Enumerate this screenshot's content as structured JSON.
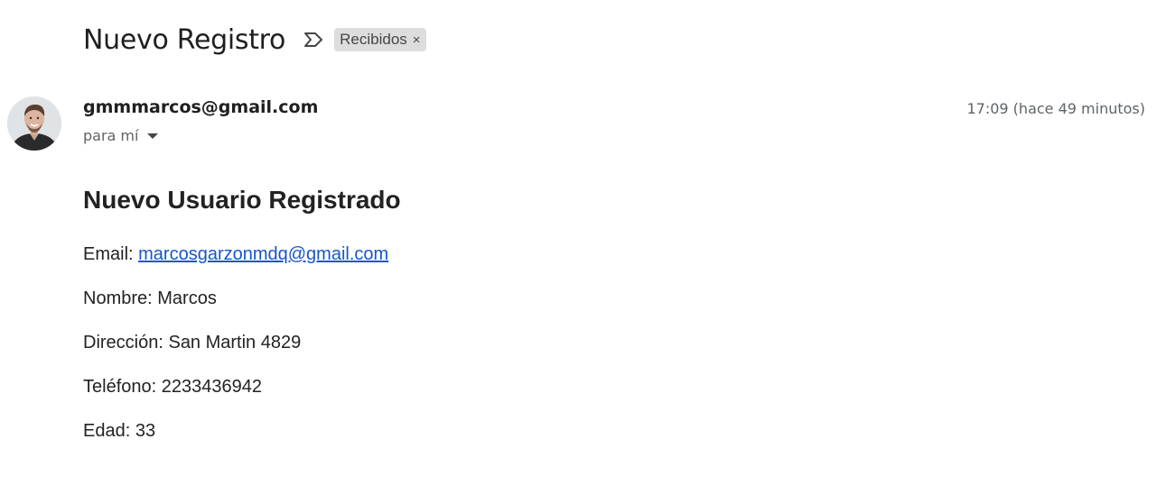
{
  "email": {
    "subject": "Nuevo Registro",
    "label": {
      "name": "Recibidos",
      "remove_glyph": "×"
    },
    "sender": "gmmmarcos@gmail.com",
    "recipient_text": "para mí",
    "timestamp": "17:09 (hace 49 minutos)",
    "icons": {
      "important": "important-marker-icon",
      "caret": "caret-down-icon",
      "avatar": "sender-avatar"
    }
  },
  "body": {
    "heading": "Nuevo Usuario Registrado",
    "email_label": "Email: ",
    "email_value": "marcosgarzonmdq@gmail.com",
    "nombre": "Nombre: Marcos",
    "direccion": "Dirección: San Martin 4829",
    "telefono": "Teléfono: 2233436942",
    "edad": "Edad: 33"
  },
  "colors": {
    "link": "#1a55c7",
    "chip_background": "#dddddd",
    "muted_text": "#5f6368"
  }
}
